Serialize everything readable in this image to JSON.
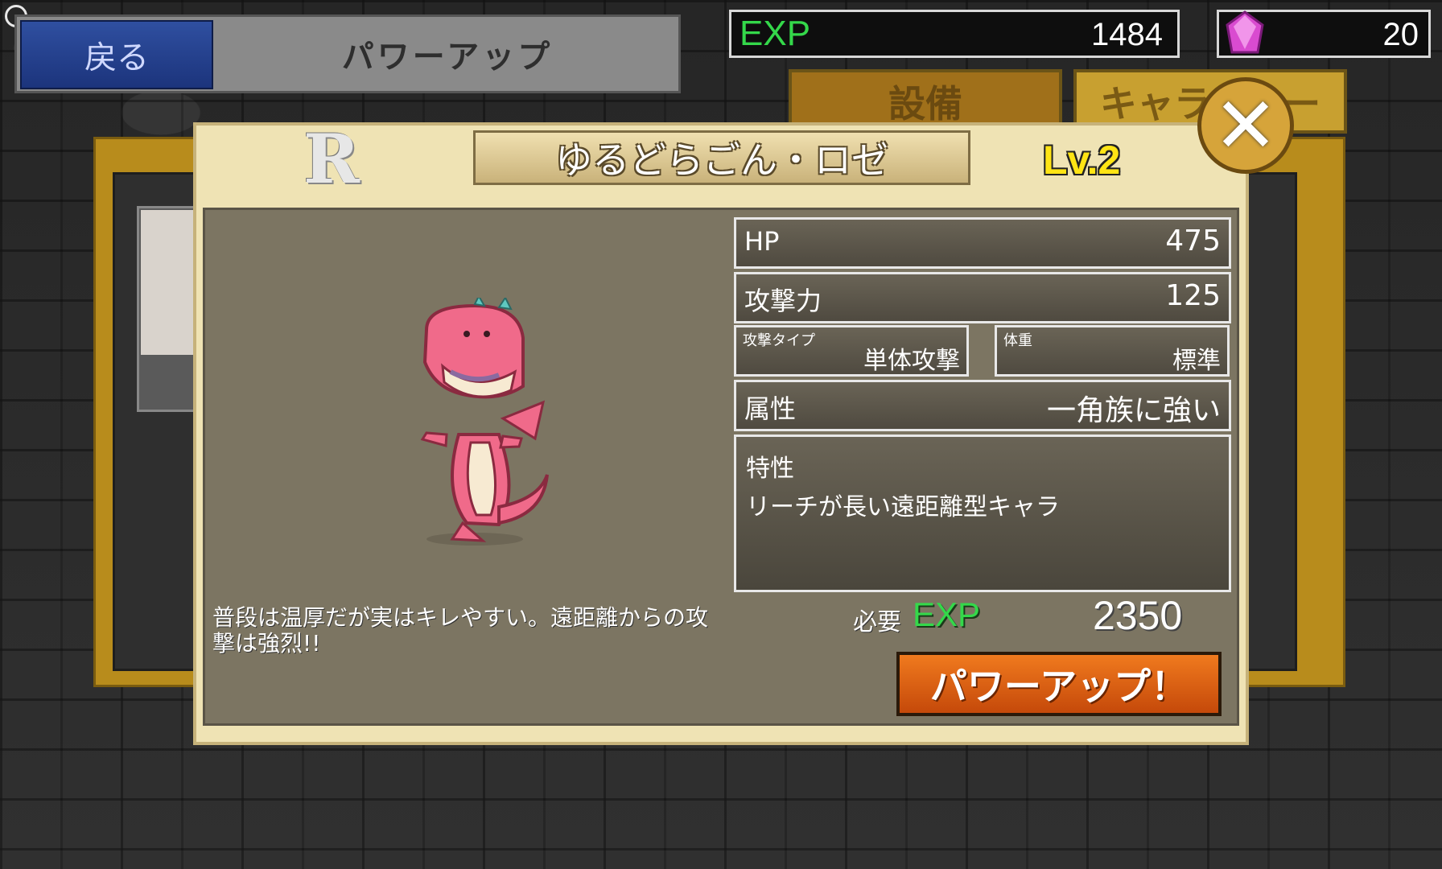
{
  "top_bar": {
    "back_label": "戻る",
    "screen_title": "パワーアップ"
  },
  "currency": {
    "exp_label": "EXP",
    "exp_value": "1484",
    "gem_value": "20"
  },
  "tabs": [
    {
      "label": "設備"
    },
    {
      "label": "キャラクター"
    }
  ],
  "character": {
    "rarity": "R",
    "name": "ゆるどらごん・ロゼ",
    "level": "Lv.2",
    "flavor_text": "普段は温厚だが実はキレやすい。遠距離からの攻撃は強烈!!"
  },
  "stats": {
    "hp_label": "HP",
    "hp_value": "475",
    "attack_label": "攻撃力",
    "attack_value": "125",
    "attack_type_label": "攻撃タイプ",
    "attack_type_value": "単体攻撃",
    "weight_label": "体重",
    "weight_value": "標準",
    "attribute_label": "属性",
    "attribute_value": "一角族に強い",
    "trait_label": "特性",
    "trait_value": "リーチが長い遠距離型キャラ"
  },
  "powerup": {
    "required_label": "必要",
    "required_exp_label": "EXP",
    "required_exp_value": "2350",
    "button_label": "パワーアップ！"
  },
  "colors": {
    "exp_green": "#34d84a",
    "level_yellow": "#ffe414",
    "powerup_orange": "#e0631a",
    "back_blue": "#2a4696",
    "dialog_cream": "#efe3b4"
  }
}
